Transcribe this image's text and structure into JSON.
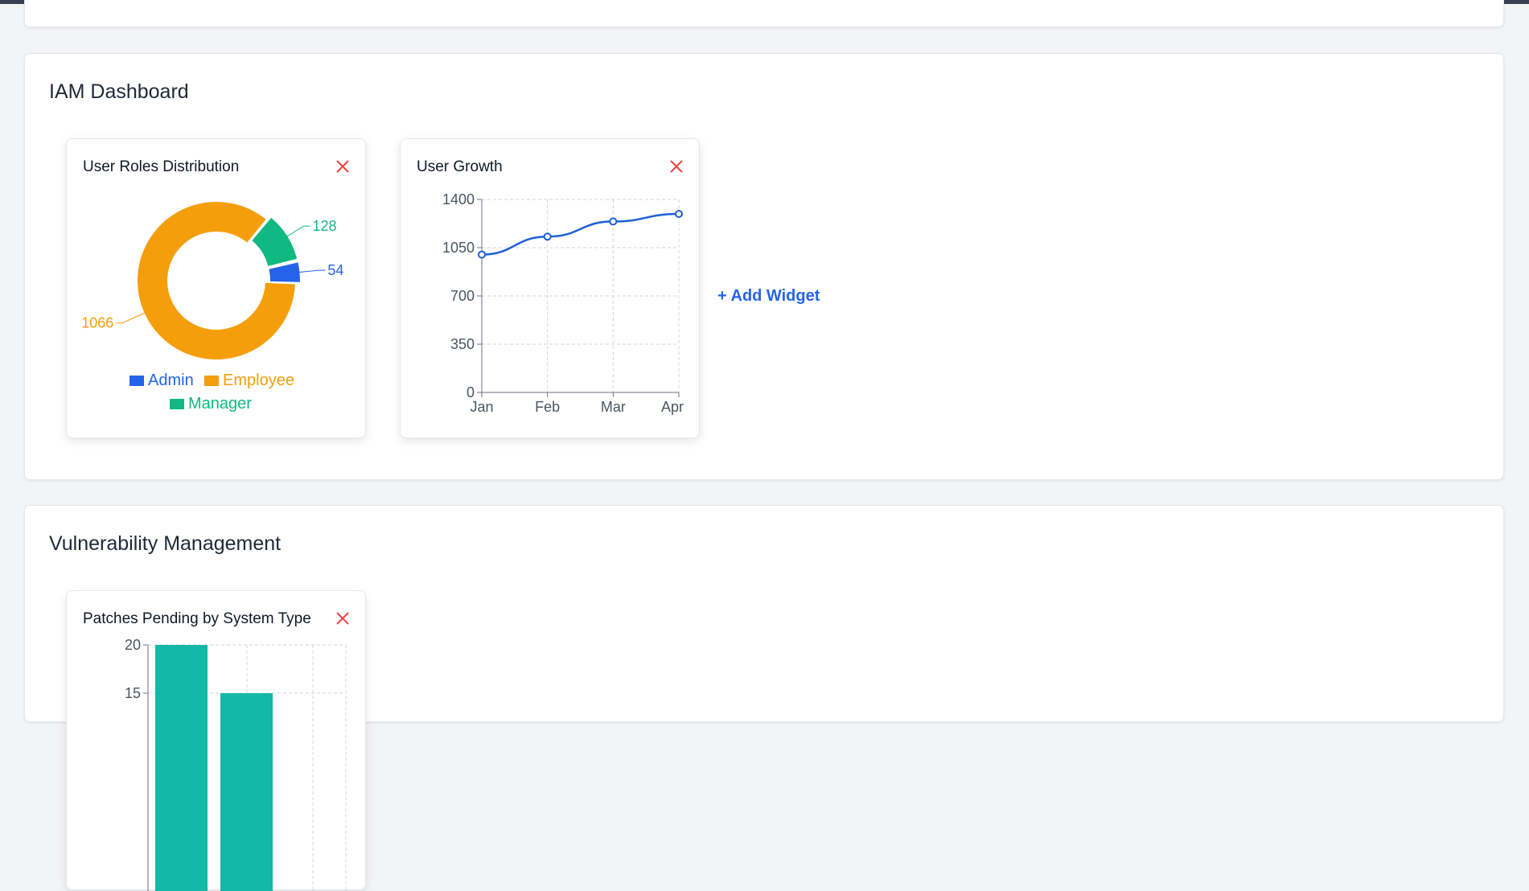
{
  "sections": {
    "iam": {
      "title": "IAM Dashboard",
      "add_widget_label": "+ Add Widget"
    },
    "vuln": {
      "title": "Vulnerability Management"
    }
  },
  "widgets": {
    "user_roles": {
      "title": "User Roles Distribution",
      "close_icon": "close-icon"
    },
    "user_growth": {
      "title": "User Growth",
      "close_icon": "close-icon"
    },
    "patches": {
      "title": "Patches Pending by System Type",
      "close_icon": "close-icon"
    }
  },
  "colors": {
    "admin": "#2563eb",
    "employee": "#f59e0b",
    "manager": "#10b981",
    "line": "#1d5fd8",
    "bar": "#14b8a6",
    "close": "#ef4444",
    "accent": "#2563eb"
  },
  "chart_data": [
    {
      "type": "pie",
      "variant": "donut",
      "title": "User Roles Distribution",
      "categories": [
        "Admin",
        "Employee",
        "Manager"
      ],
      "values": [
        54,
        1066,
        128
      ],
      "data_labels": [
        "54",
        "1066",
        "128"
      ],
      "legend": [
        "Admin",
        "Employee",
        "Manager"
      ],
      "legend_placement": "bottom"
    },
    {
      "type": "line",
      "title": "User Growth",
      "categories": [
        "Jan",
        "Feb",
        "Mar",
        "Apr"
      ],
      "values": [
        1000,
        1130,
        1240,
        1295
      ],
      "ylim": [
        0,
        1400
      ],
      "yticks": [
        "0",
        "350",
        "700",
        "1050",
        "1400"
      ],
      "grid": true
    },
    {
      "type": "bar",
      "title": "Patches Pending by System Type",
      "values": [
        20,
        15
      ],
      "visible_yticks": [
        "20",
        "15"
      ],
      "grid": true
    }
  ]
}
